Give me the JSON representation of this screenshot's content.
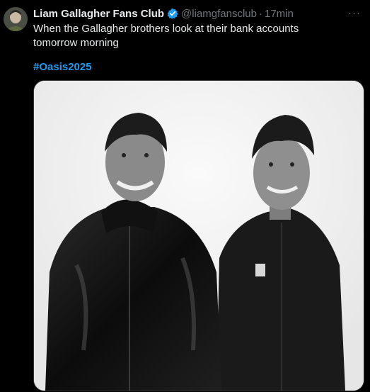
{
  "tweet": {
    "author_name": "Liam Gallagher Fans Club",
    "handle": "@liamgfansclub",
    "separator": "·",
    "time": "17min",
    "text": "When the Gallagher brothers look at their bank accounts tomorrow morning",
    "hashtag": "#Oasis2025",
    "more_label": "···"
  },
  "icons": {
    "verified": "verified-badge-icon",
    "more": "more-options-icon"
  },
  "colors": {
    "background": "#000000",
    "text": "#e7e9ea",
    "muted": "#71767b",
    "accent": "#1d9bf0"
  }
}
